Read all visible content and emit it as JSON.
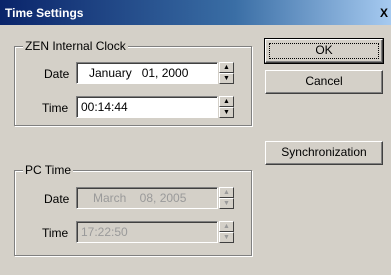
{
  "window": {
    "title": "Time Settings",
    "close_glyph": "X"
  },
  "zen_clock": {
    "legend": "ZEN Internal Clock",
    "date_label": "Date",
    "date_value": "January   01, 2000",
    "time_label": "Time",
    "time_value": "00:14:44"
  },
  "pc_time": {
    "legend": "PC Time",
    "date_label": "Date",
    "date_value": "March    08, 2005",
    "time_label": "Time",
    "time_value": "17:22:50"
  },
  "buttons": {
    "ok": "OK",
    "cancel": "Cancel",
    "sync": "Synchronization"
  },
  "icons": {
    "spin_up": "▲",
    "spin_down": "▼"
  }
}
